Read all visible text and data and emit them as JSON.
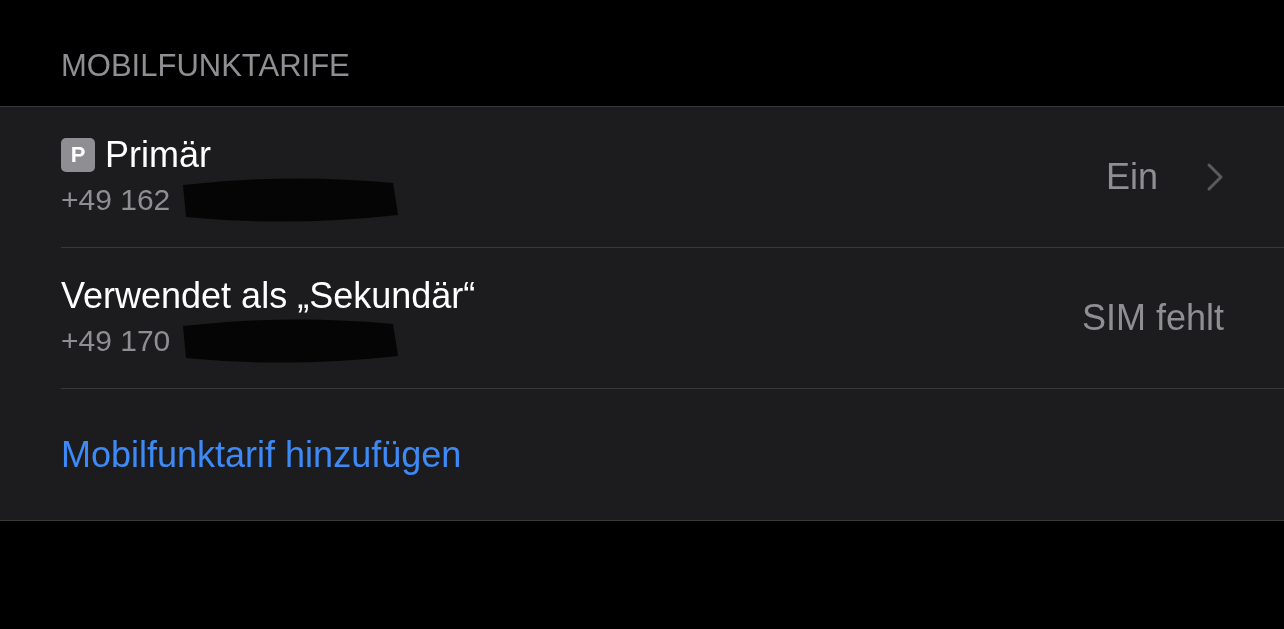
{
  "section_header": "MOBILFUNKTARIFE",
  "plans": [
    {
      "badge": "P",
      "title": "Primär",
      "number": "+49 162",
      "value": "Ein",
      "chevron": true,
      "redacted": true
    },
    {
      "title": "Verwendet als „Sekundär“",
      "number": "+49 170",
      "value": "SIM fehlt",
      "chevron": false,
      "redacted": true
    }
  ],
  "add_link": "Mobilfunktarif hinzufügen"
}
